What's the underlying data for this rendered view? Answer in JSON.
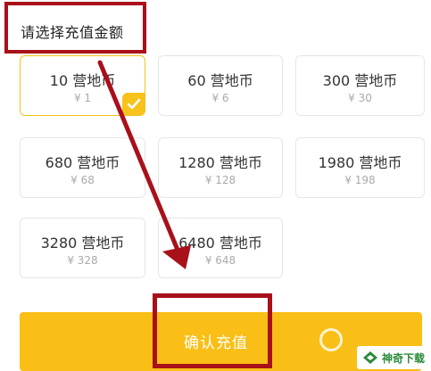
{
  "header": {
    "title": "请选择充值金额"
  },
  "options": [
    {
      "amount": "10 营地币",
      "price": "¥ 1",
      "selected": true
    },
    {
      "amount": "60 营地币",
      "price": "¥ 6",
      "selected": false
    },
    {
      "amount": "300 营地币",
      "price": "¥ 30",
      "selected": false
    },
    {
      "amount": "680 营地币",
      "price": "¥ 68",
      "selected": false
    },
    {
      "amount": "1280 营地币",
      "price": "¥ 128",
      "selected": false
    },
    {
      "amount": "1980 营地币",
      "price": "¥ 198",
      "selected": false
    },
    {
      "amount": "3280 营地币",
      "price": "¥ 328",
      "selected": false
    },
    {
      "amount": "6480 营地币",
      "price": "¥ 648",
      "selected": false
    }
  ],
  "confirm": {
    "label": "确认充值"
  },
  "watermark": {
    "text": "神奇下载"
  },
  "colors": {
    "accent": "#f9bf16",
    "annotation": "#a8101a"
  },
  "icons": {
    "selected_mark": "checkmark-icon"
  }
}
